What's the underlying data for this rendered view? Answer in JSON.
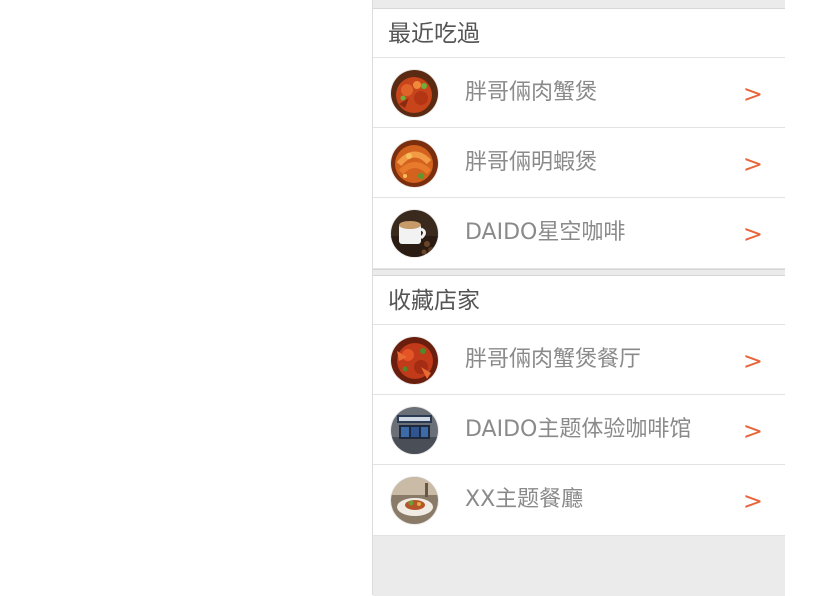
{
  "recent": {
    "title": "最近吃過",
    "items": [
      {
        "label": "胖哥倆肉蟹煲",
        "chevron": ">",
        "thumb": "crab-pot-thumbnail"
      },
      {
        "label": "胖哥倆明蝦煲",
        "chevron": ">",
        "thumb": "shrimp-pot-thumbnail"
      },
      {
        "label": "DAIDO星空咖啡",
        "chevron": ">",
        "thumb": "coffee-cup-thumbnail"
      }
    ]
  },
  "favorites": {
    "title": "收藏店家",
    "items": [
      {
        "label": "胖哥倆肉蟹煲餐厅",
        "chevron": ">",
        "thumb": "crab-dish-thumbnail"
      },
      {
        "label": "DAIDO主题体验咖啡馆",
        "chevron": ">",
        "thumb": "cafe-storefront-thumbnail"
      },
      {
        "label": "XX主题餐廳",
        "chevron": ">",
        "thumb": "restaurant-dish-thumbnail"
      }
    ]
  },
  "colors": {
    "accent": "#e8643a",
    "label": "#8a8a8a",
    "header": "#555555",
    "background": "#ebebeb"
  }
}
